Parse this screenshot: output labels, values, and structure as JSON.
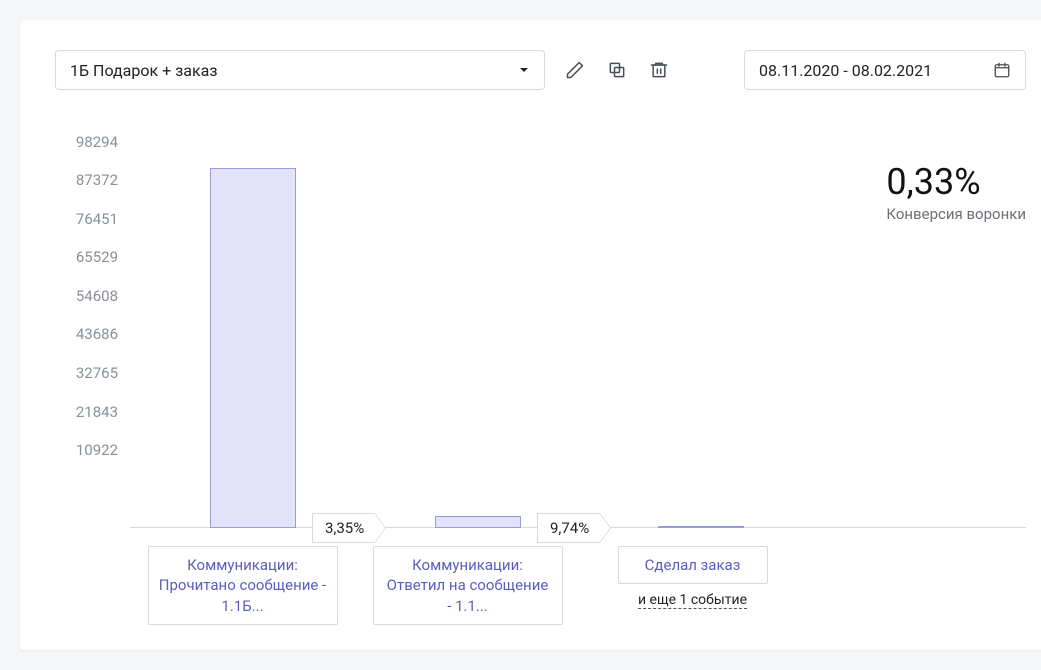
{
  "toolbar": {
    "select_label": "1Б Подарок + заказ",
    "date_range": "08.11.2020 - 08.02.2021"
  },
  "summary": {
    "value": "0,33%",
    "label": "Конверсия воронки"
  },
  "y_ticks": [
    "98294",
    "87372",
    "76451",
    "65529",
    "54608",
    "43686",
    "32765",
    "21843",
    "10922"
  ],
  "conversions": [
    "3,35%",
    "9,74%"
  ],
  "x_labels": [
    "Коммуникации: Прочитано сообщение - 1.1Б...",
    "Коммуникации: Ответил на сообщение - 1.1...",
    "Сделал заказ"
  ],
  "more_events": "и еще 1 событие",
  "chart_data": {
    "type": "bar",
    "categories": [
      "Коммуникации: Прочитано сообщение - 1.1Б...",
      "Коммуникации: Ответил на сообщение - 1.1...",
      "Сделал заказ"
    ],
    "values": [
      92000,
      3080,
      300
    ],
    "step_conversion_pct": [
      3.35,
      9.74
    ],
    "funnel_conversion_pct": 0.33,
    "ylim": [
      0,
      98294
    ],
    "title": "",
    "xlabel": "",
    "ylabel": ""
  }
}
